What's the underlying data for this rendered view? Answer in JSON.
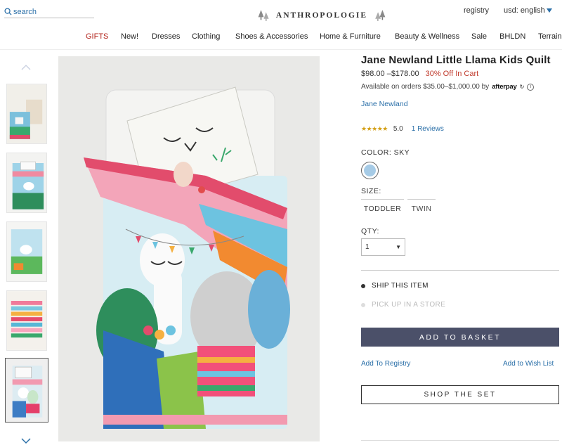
{
  "header": {
    "search_placeholder": "search",
    "logo_text": "ANTHROPOLOGIE",
    "registry": "registry",
    "currency": "usd: english"
  },
  "nav": [
    "GIFTS",
    "New!",
    "Dresses",
    "Clothing",
    "Shoes & Accessories",
    "Home & Furniture",
    "Beauty & Wellness",
    "Sale",
    "BHLDN",
    "Terrain"
  ],
  "product": {
    "title": "Jane Newland Little Llama Kids Quilt",
    "price": "$98.00 –$178.00",
    "discount": "30% Off In Cart",
    "afterpay_text": "Available on orders $35.00–$1,000.00 by",
    "afterpay_logo": "afterpay",
    "afterpay_info": "i",
    "brand": "Jane Newland",
    "stars": "★★★★★",
    "rating": "5.0",
    "reviews": "1 Reviews",
    "color_label": "COLOR: SKY",
    "swatch_color": "#a6cbe6",
    "size_label": "SIZE:",
    "sizes": [
      "TODDLER",
      "TWIN"
    ],
    "qty_label": "QTY:",
    "qty_value": "1",
    "ship": "SHIP THIS ITEM",
    "pickup": "PICK UP IN A STORE",
    "add_basket": "ADD TO BASKET",
    "add_registry": "Add To Registry",
    "add_wishlist": "Add to Wish List",
    "shop_set": "SHOP THE SET"
  },
  "colors": {
    "accent_button": "#4b5069",
    "link": "#2a6fa8",
    "sale_red": "#c0392b",
    "gifts_red": "#b3261e"
  }
}
